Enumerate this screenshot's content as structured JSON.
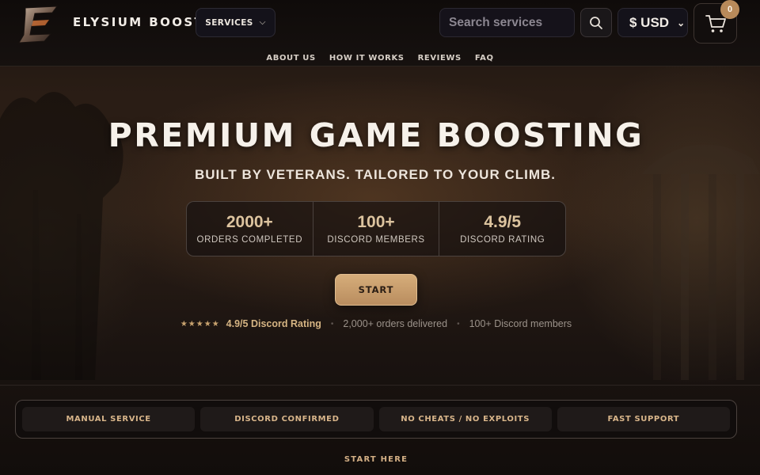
{
  "header": {
    "brand": "ELYSIUM BOOST",
    "services_label": "SERVICES",
    "search_placeholder": "Search services",
    "currency": "$ USD",
    "cart_count": "0"
  },
  "subnav": [
    "ABOUT US",
    "HOW IT WORKS",
    "REVIEWS",
    "FAQ"
  ],
  "hero": {
    "title": "PREMIUM GAME BOOSTING",
    "subtitle": "BUILT BY VETERANS. TAILORED TO YOUR CLIMB.",
    "stats": [
      {
        "value": "2000+",
        "label": "ORDERS COMPLETED"
      },
      {
        "value": "100+",
        "label": "DISCORD MEMBERS"
      },
      {
        "value": "4.9/5",
        "label": "DISCORD RATING"
      }
    ],
    "start_label": "START",
    "trust": {
      "stars": "★★★★★",
      "rating": "4.9/5 Discord Rating",
      "orders": "2,000+ orders delivered",
      "members": "100+ Discord members"
    }
  },
  "features": [
    "MANUAL SERVICE",
    "DISCORD CONFIRMED",
    "NO CHEATS / NO EXPLOITS",
    "FAST SUPPORT"
  ],
  "start_here": "START HERE",
  "colors": {
    "accent_gold": "#d6ad7a",
    "background": "#120d0b",
    "badge": "#b88a5a"
  },
  "icons": {
    "logo": "logo-emblem-icon",
    "search": "search-icon",
    "cart": "cart-icon",
    "chevron": "chevron-down-icon"
  }
}
